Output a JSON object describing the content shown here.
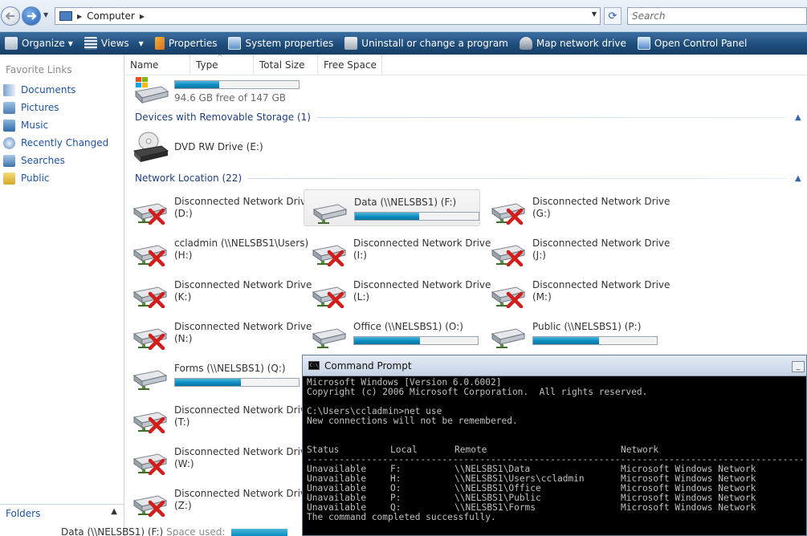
{
  "address_bar": {
    "crumbs": [
      "Computer"
    ],
    "search_placeholder": "Search",
    "back_icon": "back-arrow-icon",
    "forward_icon": "forward-arrow-icon"
  },
  "toolbar": {
    "items": [
      "Organize",
      "Views",
      "Properties",
      "System properties",
      "Uninstall or change a program",
      "Map network drive",
      "Open Control Panel"
    ]
  },
  "sidebar": {
    "title": "Favorite Links",
    "links": [
      "Documents",
      "Pictures",
      "Music",
      "Recently Changed",
      "Searches",
      "Public"
    ],
    "folders_label": "Folders"
  },
  "columns": [
    "Name",
    "Type",
    "Total Size",
    "Free Space"
  ],
  "local_disk": {
    "free_text": "94.6 GB free of 147 GB",
    "used_fraction": 0.36
  },
  "groups": {
    "removable": "Devices with Removable Storage (1)",
    "network": "Network Location (22)"
  },
  "dvd": {
    "name": "DVD RW Drive (E:)"
  },
  "network_drives": [
    {
      "name": "Disconnected Network Drive",
      "letter": "(D:)"
    },
    {
      "name": "Data (\\\\NELSBS1) (F:)",
      "used_fraction": 0.52
    },
    {
      "name": "Disconnected Network Drive",
      "letter": "(G:)"
    },
    {
      "name": "ccladmin (\\\\NELSBS1\\Users)",
      "letter": "(H:)"
    },
    {
      "name": "Disconnected Network Drive",
      "letter": "(I:)"
    },
    {
      "name": "Disconnected Network Drive",
      "letter": "(J:)"
    },
    {
      "name": "Disconnected Network Drive",
      "letter": "(K:)"
    },
    {
      "name": "Disconnected Network Drive",
      "letter": "(L:)"
    },
    {
      "name": "Disconnected Network Drive",
      "letter": "(M:)"
    },
    {
      "name": "Disconnected Network Drive",
      "letter": "(N:)"
    },
    {
      "name": "Office (\\\\NELSBS1) (O:)",
      "used_fraction": 0.53
    },
    {
      "name": "Public (\\\\NELSBS1) (P:)",
      "used_fraction": 0.53
    },
    {
      "name": "Forms (\\\\NELSBS1) (Q:)",
      "used_fraction": 0.53
    },
    {
      "name": "Disconnected Network Drive",
      "letter": "(T:)"
    },
    {
      "name": "Disconnected Network Drive",
      "letter": "(W:)"
    },
    {
      "name": "Disconnected Network Drive",
      "letter": "(Z:)"
    }
  ],
  "status_line": {
    "name": "Data (\\\\NELSBS1) (F:)",
    "label": "Space used:"
  },
  "cmd": {
    "title": "Command Prompt",
    "lines": [
      "Microsoft Windows [Version 6.0.6002]",
      "Copyright (c) 2006 Microsoft Corporation.  All rights reserved.",
      "",
      "C:\\Users\\ccladmin>net use",
      "New connections will not be remembered.",
      "",
      ""
    ],
    "table_header": [
      "Status",
      "Local",
      "Remote",
      "Network"
    ],
    "rows": [
      [
        "Unavailable",
        "F:",
        "\\\\NELSBS1\\Data",
        "Microsoft Windows Network"
      ],
      [
        "Unavailable",
        "H:",
        "\\\\NELSBS1\\Users\\ccladmin",
        "Microsoft Windows Network"
      ],
      [
        "Unavailable",
        "O:",
        "\\\\NELSBS1\\Office",
        "Microsoft Windows Network"
      ],
      [
        "Unavailable",
        "P:",
        "\\\\NELSBS1\\Public",
        "Microsoft Windows Network"
      ],
      [
        "Unavailable",
        "Q:",
        "\\\\NELSBS1\\Forms",
        "Microsoft Windows Network"
      ]
    ],
    "footer": "The command completed successfully."
  }
}
